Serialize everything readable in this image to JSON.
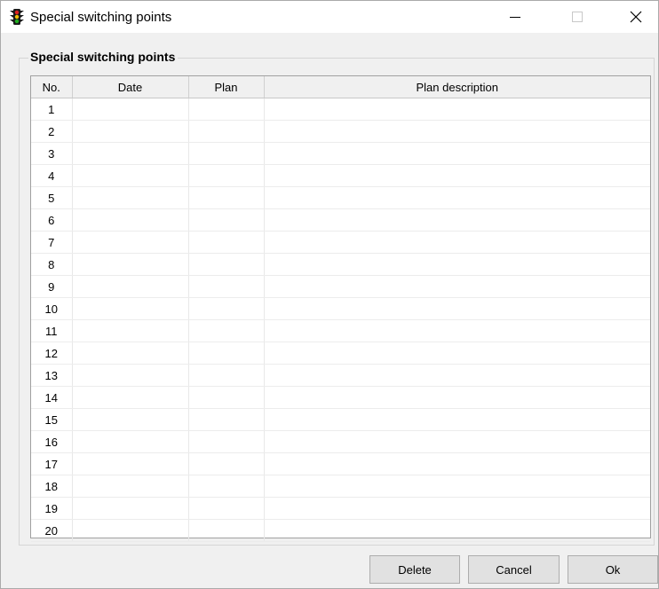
{
  "window": {
    "title": "Special switching points",
    "icon": "traffic-light-icon"
  },
  "group": {
    "title": "Special switching points"
  },
  "table": {
    "columns": [
      "No.",
      "Date",
      "Plan",
      "Plan description"
    ],
    "rows": [
      {
        "no": "1",
        "date": "",
        "plan": "",
        "description": ""
      },
      {
        "no": "2",
        "date": "",
        "plan": "",
        "description": ""
      },
      {
        "no": "3",
        "date": "",
        "plan": "",
        "description": ""
      },
      {
        "no": "4",
        "date": "",
        "plan": "",
        "description": ""
      },
      {
        "no": "5",
        "date": "",
        "plan": "",
        "description": ""
      },
      {
        "no": "6",
        "date": "",
        "plan": "",
        "description": ""
      },
      {
        "no": "7",
        "date": "",
        "plan": "",
        "description": ""
      },
      {
        "no": "8",
        "date": "",
        "plan": "",
        "description": ""
      },
      {
        "no": "9",
        "date": "",
        "plan": "",
        "description": ""
      },
      {
        "no": "10",
        "date": "",
        "plan": "",
        "description": ""
      },
      {
        "no": "11",
        "date": "",
        "plan": "",
        "description": ""
      },
      {
        "no": "12",
        "date": "",
        "plan": "",
        "description": ""
      },
      {
        "no": "13",
        "date": "",
        "plan": "",
        "description": ""
      },
      {
        "no": "14",
        "date": "",
        "plan": "",
        "description": ""
      },
      {
        "no": "15",
        "date": "",
        "plan": "",
        "description": ""
      },
      {
        "no": "16",
        "date": "",
        "plan": "",
        "description": ""
      },
      {
        "no": "17",
        "date": "",
        "plan": "",
        "description": ""
      },
      {
        "no": "18",
        "date": "",
        "plan": "",
        "description": ""
      },
      {
        "no": "19",
        "date": "",
        "plan": "",
        "description": ""
      },
      {
        "no": "20",
        "date": "",
        "plan": "",
        "description": ""
      }
    ]
  },
  "buttons": {
    "delete": "Delete",
    "cancel": "Cancel",
    "ok": "Ok"
  }
}
